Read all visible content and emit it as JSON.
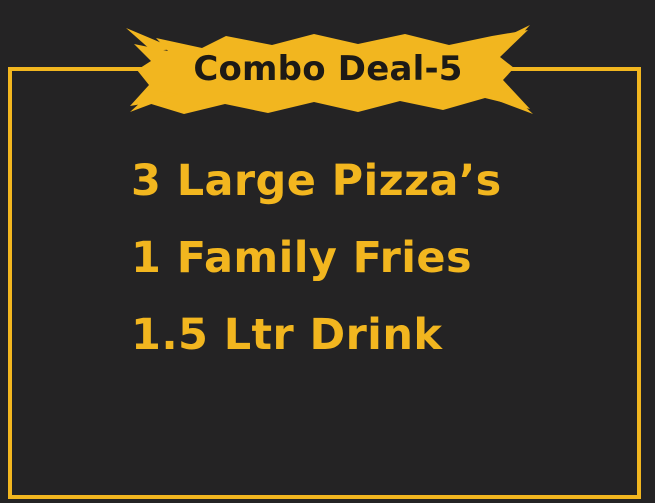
{
  "banner": {
    "title": "Combo Deal-5"
  },
  "items": [
    "3 Large Pizza’s",
    "1 Family Fries",
    "1.5 Ltr Drink"
  ],
  "colors": {
    "background": "#242324",
    "accent": "#f2b61f",
    "banner_text": "#1d1a16"
  }
}
